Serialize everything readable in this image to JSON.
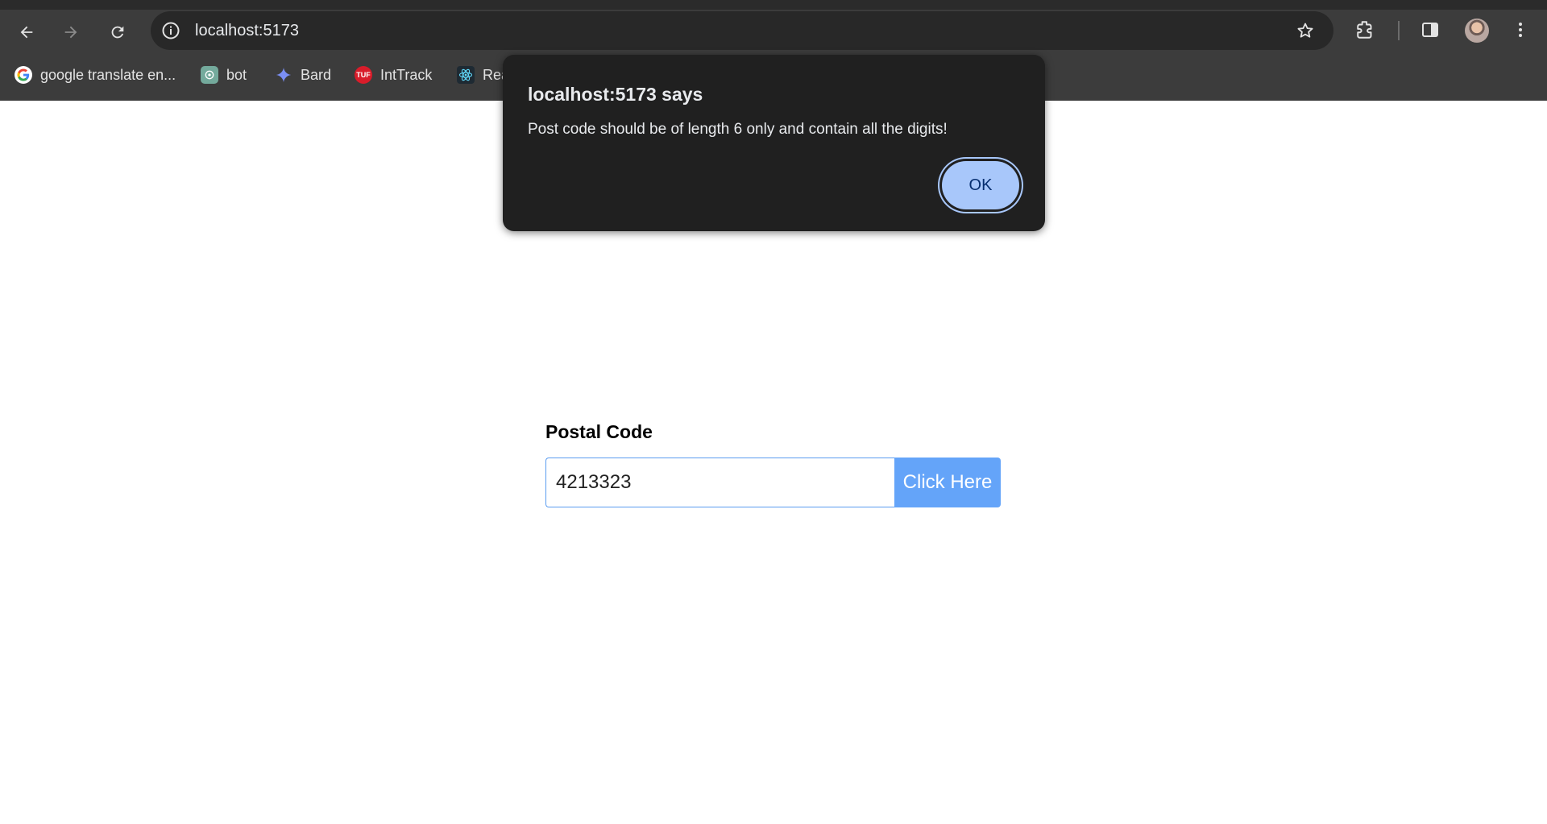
{
  "browser": {
    "url": "localhost:5173",
    "bookmarks": [
      {
        "label": "google translate en...",
        "icon": "google-icon"
      },
      {
        "label": "bot",
        "icon": "chatgpt-icon"
      },
      {
        "label": "Bard",
        "icon": "bard-sparkle-icon"
      },
      {
        "label": "IntTrack",
        "icon": "tuf-icon",
        "icon_text": "TUF"
      },
      {
        "label": "Rea",
        "icon": "react-icon"
      }
    ]
  },
  "page": {
    "field_label": "Postal Code",
    "input_value": "4213323",
    "button_label": "Click Here"
  },
  "dialog": {
    "title": "localhost:5173 says",
    "message": "Post code should be of length 6 only and contain all the digits!",
    "ok_label": "OK"
  }
}
